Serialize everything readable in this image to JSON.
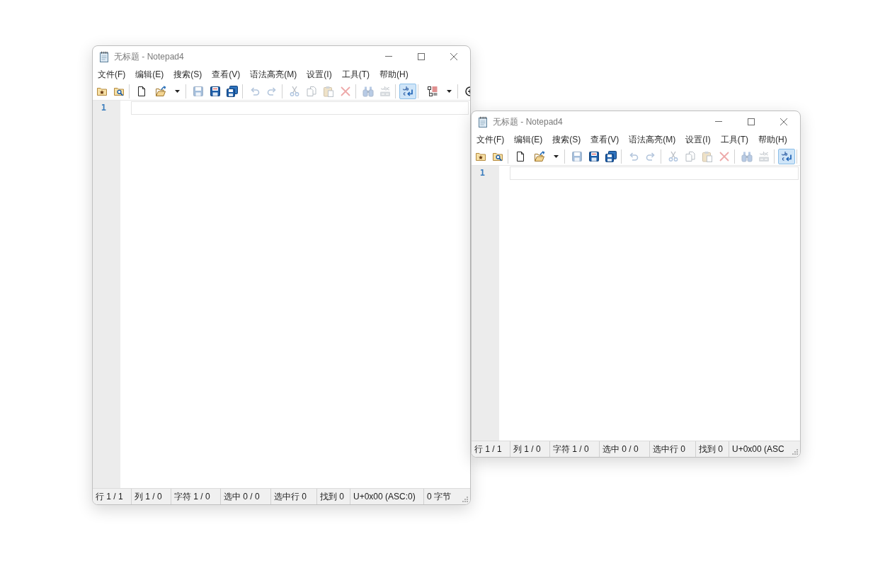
{
  "windows": [
    {
      "title": "无标题 - Notepad4",
      "menu": [
        "文件(F)",
        "编辑(E)",
        "搜索(S)",
        "查看(V)",
        "语法高亮(M)",
        "设置(I)",
        "工具(T)",
        "帮助(H)"
      ],
      "toolbar": [
        {
          "buttons": [
            {
              "kind": "button",
              "disabled": false,
              "on": false
            },
            {
              "kind": "button",
              "disabled": false,
              "on": false
            }
          ]
        },
        {
          "buttons": [
            {
              "kind": "button",
              "disabled": false,
              "on": false
            },
            {
              "kind": "split",
              "disabled": false,
              "on": false
            }
          ]
        },
        {
          "buttons": [
            {
              "kind": "button",
              "disabled": true,
              "on": false
            },
            {
              "kind": "button",
              "disabled": false,
              "on": false
            },
            {
              "kind": "button",
              "disabled": false,
              "on": false
            }
          ]
        },
        {
          "buttons": [
            {
              "kind": "button",
              "disabled": true,
              "on": false
            },
            {
              "kind": "button",
              "disabled": true,
              "on": false
            }
          ]
        },
        {
          "buttons": [
            {
              "kind": "button",
              "disabled": true,
              "on": false
            },
            {
              "kind": "button",
              "disabled": true,
              "on": false
            },
            {
              "kind": "button",
              "disabled": true,
              "on": false
            },
            {
              "kind": "button",
              "disabled": true,
              "on": false
            }
          ]
        },
        {
          "buttons": [
            {
              "kind": "button",
              "disabled": true,
              "on": false
            },
            {
              "kind": "button",
              "disabled": true,
              "on": false
            }
          ]
        },
        {
          "buttons": [
            {
              "kind": "button",
              "disabled": false,
              "on": true
            }
          ]
        },
        {
          "buttons": [
            {
              "kind": "split",
              "disabled": false,
              "on": false
            }
          ]
        },
        {
          "buttons": [
            {
              "kind": "button",
              "disabled": false,
              "on": false
            }
          ]
        }
      ],
      "editor": {
        "line_numbers": [
          "1"
        ]
      },
      "status_bar": [
        "行 1 / 1",
        "列 1 / 0",
        "字符 1 / 0",
        "选中 0 / 0",
        "选中行 0",
        "找到 0",
        "U+0x00 (ASC:0)",
        "0 字节"
      ]
    },
    {
      "title": "无标题 - Notepad4",
      "menu": [
        "文件(F)",
        "编辑(E)",
        "搜索(S)",
        "查看(V)",
        "语法高亮(M)",
        "设置(I)",
        "工具(T)",
        "帮助(H)"
      ],
      "toolbar": [
        {
          "buttons": [
            {
              "kind": "button",
              "disabled": false,
              "on": false
            },
            {
              "kind": "button",
              "disabled": false,
              "on": false
            }
          ]
        },
        {
          "buttons": [
            {
              "kind": "button",
              "disabled": false,
              "on": false
            },
            {
              "kind": "split",
              "disabled": false,
              "on": false
            }
          ]
        },
        {
          "buttons": [
            {
              "kind": "button",
              "disabled": true,
              "on": false
            },
            {
              "kind": "button",
              "disabled": false,
              "on": false
            },
            {
              "kind": "button",
              "disabled": false,
              "on": false
            }
          ]
        },
        {
          "buttons": [
            {
              "kind": "button",
              "disabled": true,
              "on": false
            },
            {
              "kind": "button",
              "disabled": true,
              "on": false
            }
          ]
        },
        {
          "buttons": [
            {
              "kind": "button",
              "disabled": true,
              "on": false
            },
            {
              "kind": "button",
              "disabled": true,
              "on": false
            },
            {
              "kind": "button",
              "disabled": true,
              "on": false
            },
            {
              "kind": "button",
              "disabled": true,
              "on": false
            }
          ]
        },
        {
          "buttons": [
            {
              "kind": "button",
              "disabled": true,
              "on": false
            },
            {
              "kind": "button",
              "disabled": true,
              "on": false
            }
          ]
        },
        {
          "buttons": [
            {
              "kind": "button",
              "disabled": false,
              "on": true
            }
          ]
        }
      ],
      "editor": {
        "line_numbers": [
          "1"
        ]
      },
      "status_bar": [
        "行 1 / 1",
        "列 1 / 0",
        "字符 1 / 0",
        "选中 0 / 0",
        "选中行 0",
        "找到 0",
        "U+0x00 (ASC"
      ]
    }
  ]
}
